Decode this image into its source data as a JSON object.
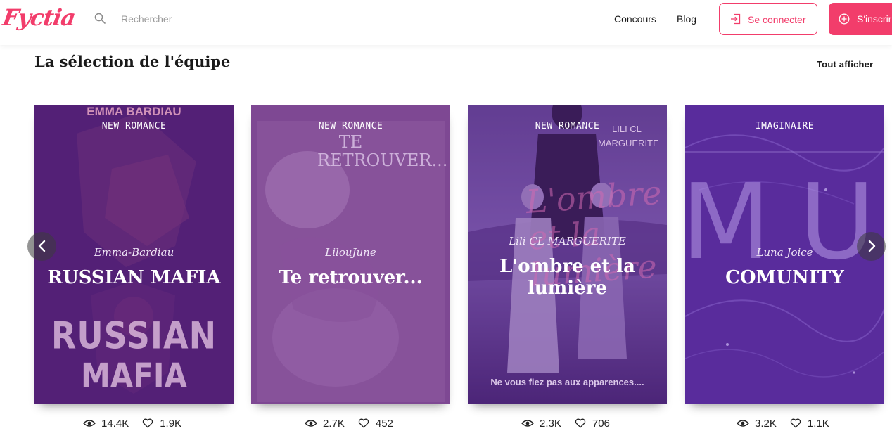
{
  "header": {
    "logo_text": "Fyctia",
    "search_placeholder": "Rechercher",
    "nav": {
      "contest": "Concours",
      "blog": "Blog"
    },
    "login_label": "Se connecter",
    "signup_label": "S'inscrire",
    "brand_color": "#f23d6b"
  },
  "section": {
    "title": "La sélection de l'équipe",
    "see_all": "Tout afficher"
  },
  "cards": [
    {
      "genre": "NEW ROMANCE",
      "author": "Emma-Bardiau",
      "title": "RUSSIAN MAFIA",
      "cover_top": "EMMA BARDIAU",
      "cover_word1": "RUSSIAN",
      "cover_word2": "MAFIA",
      "views": "14.4K",
      "likes": "1.9K"
    },
    {
      "genre": "NEW ROMANCE",
      "author": "LilouJune",
      "title": "Te retrouver...",
      "cover_title_a": "TE",
      "cover_title_b": "RETROUVER...",
      "views": "2.7K",
      "likes": "452"
    },
    {
      "genre": "NEW ROMANCE",
      "author": "Lili CL MARGUERITE",
      "title_line1": "L'ombre et la",
      "title_line2": "lumière",
      "cover_author_a": "LILI CL",
      "cover_author_b": "MARGUERITE",
      "cover_script": "L'ombre et la lumière",
      "tagline": "Ne vous fiez pas aux apparences....",
      "views": "2.3K",
      "likes": "706"
    },
    {
      "genre": "IMAGINAIRE",
      "author": "Luna Joice",
      "title": "COMUNITY",
      "cover_letters": "MUN",
      "views": "3.2K",
      "likes": "1.1K"
    }
  ],
  "icons": {
    "search": "search-icon",
    "login": "login-icon",
    "signup": "plus-circle-icon",
    "views": "eye-icon",
    "likes": "heart-icon",
    "prev": "chevron-left-icon",
    "next": "chevron-right-icon"
  }
}
